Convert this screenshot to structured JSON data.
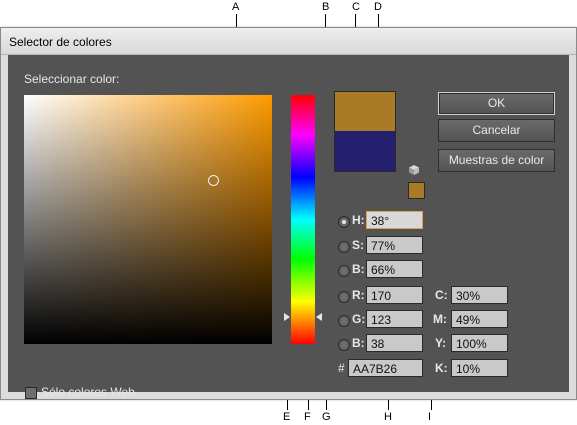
{
  "window": {
    "title": "Selector de colores"
  },
  "field": {
    "label": "Seleccionar color:"
  },
  "buttons": {
    "ok": "OK",
    "cancel": "Cancelar",
    "swatches": "Muestras de color"
  },
  "hsb": [
    {
      "label": "H:",
      "value": "38°",
      "selected": true
    },
    {
      "label": "S:",
      "value": "77%",
      "selected": false
    },
    {
      "label": "B:",
      "value": "66%",
      "selected": false
    }
  ],
  "rgb": [
    {
      "label": "R:",
      "value": "170"
    },
    {
      "label": "G:",
      "value": "123"
    },
    {
      "label": "B:",
      "value": "38"
    }
  ],
  "hex": {
    "label": "#",
    "value": "AA7B26"
  },
  "cmyk": [
    {
      "label": "C:",
      "value": "30%"
    },
    {
      "label": "M:",
      "value": "49%"
    },
    {
      "label": "Y:",
      "value": "100%"
    },
    {
      "label": "K:",
      "value": "10%"
    }
  ],
  "web_only": {
    "label": "Sólo colores Web"
  },
  "callouts": [
    "A",
    "B",
    "C",
    "D",
    "E",
    "F",
    "G",
    "H",
    "I"
  ],
  "colors": {
    "new_color": "#AA7B26",
    "old_color": "#241F6E",
    "panel": "#535353"
  }
}
